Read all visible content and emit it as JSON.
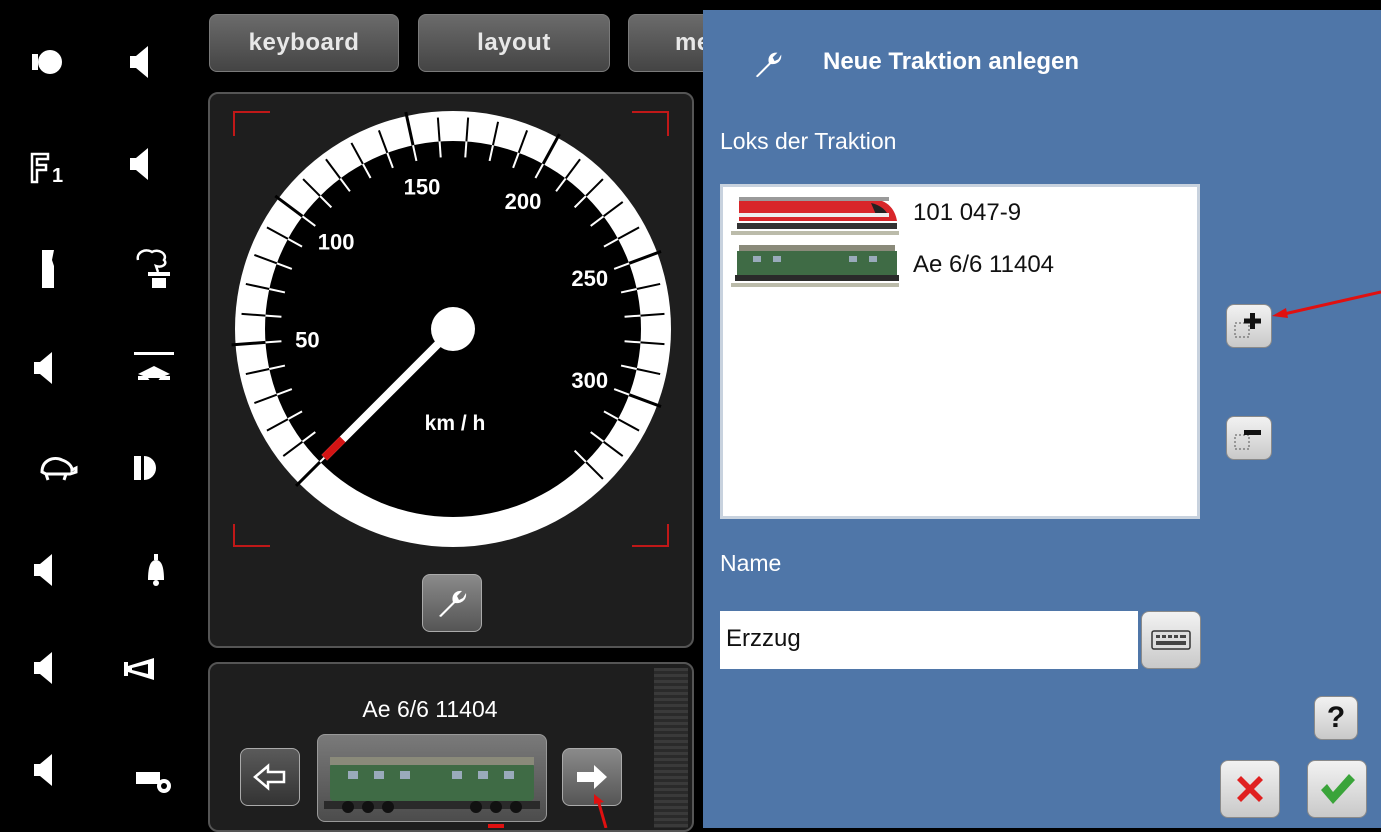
{
  "tabs": [
    "keyboard",
    "layout",
    "me"
  ],
  "functions": {
    "left": [
      "light-icon",
      "sound-icon",
      "f1-icon",
      "sound-icon",
      "sound-icon",
      "shunting-icon",
      "sound-icon",
      "sound-icon"
    ],
    "right": [
      "sound-icon",
      "sound-icon",
      "smoke-icon",
      "pantograph-icon",
      "light-icon",
      "bell-icon",
      "horn-icon",
      "whistle-icon"
    ],
    "f1_label": "F1"
  },
  "speedometer": {
    "unit": "km / h",
    "tick_labels": [
      "50",
      "100",
      "150",
      "200",
      "250",
      "300"
    ],
    "speed": 0
  },
  "loco_selector": {
    "name": "Ae 6/6 11404"
  },
  "dialog": {
    "title": "Neue Traktion anlegen",
    "locos_label": "Loks der Traktion",
    "locos": [
      {
        "name": "101 047-9",
        "color": "#d8262a"
      },
      {
        "name": "Ae 6/6 11404",
        "color": "#3f6b45"
      }
    ],
    "name_label": "Name",
    "name_value": "Erzzug",
    "help_label": "?"
  },
  "colors": {
    "dialog_bg": "#4f76a8",
    "needle_tip": "#d41414",
    "arrow": "#e01010",
    "cancel": "#e02020",
    "confirm": "#3aa43a"
  }
}
